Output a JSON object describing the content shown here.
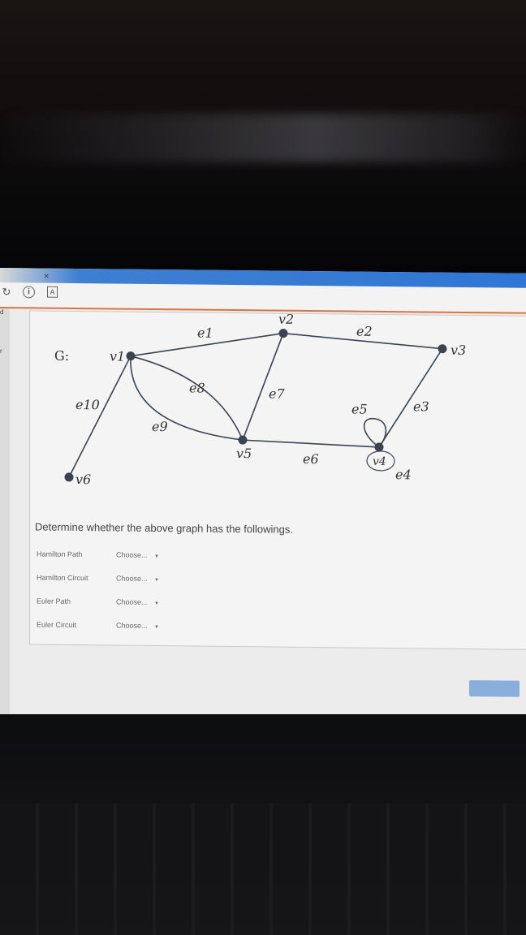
{
  "browser": {
    "close_label": "×",
    "info_label": "i",
    "pdf_label": "A",
    "side_labels": [
      "d",
      "r"
    ]
  },
  "graph": {
    "title": "G:",
    "vertices": {
      "v1": "v1",
      "v2": "v2",
      "v3": "v3",
      "v4": "v4",
      "v5": "v5",
      "v6": "v6"
    },
    "edges": {
      "e1": "e1",
      "e2": "e2",
      "e3": "e3",
      "e4": "e4",
      "e5": "e5",
      "e6": "e6",
      "e7": "e7",
      "e8": "e8",
      "e9": "e9",
      "e10": "e10"
    }
  },
  "question": {
    "prompt": "Determine whether the above graph has the followings.",
    "rows": [
      {
        "label": "Hamilton Path",
        "selected": "Choose..."
      },
      {
        "label": "Hamilton Circuit",
        "selected": "Choose..."
      },
      {
        "label": "Euler Path",
        "selected": "Choose..."
      },
      {
        "label": "Euler Circuit",
        "selected": "Choose..."
      }
    ],
    "dropdown_arrow": "▼"
  },
  "colors": {
    "accent_blue": "#2f76d6",
    "toolbar_underline": "#d9743d",
    "graph_ink": "#3b4352"
  }
}
